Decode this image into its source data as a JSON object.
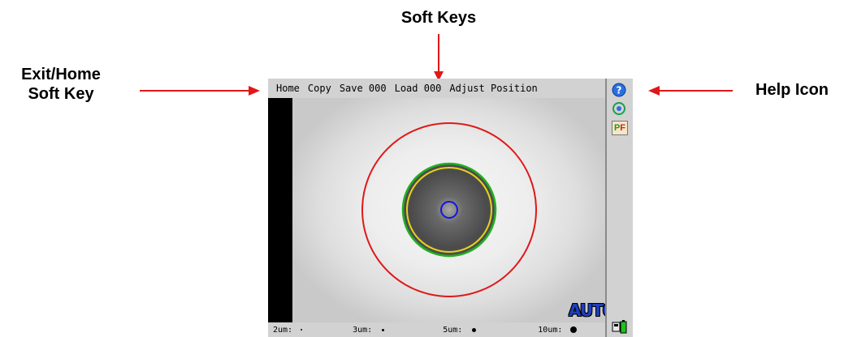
{
  "callouts": {
    "soft_keys": "Soft Keys",
    "exit_home_line1": "Exit/Home",
    "exit_home_line2": "Soft Key",
    "help_icon": "Help Icon"
  },
  "softkeys": {
    "home": "Home",
    "copy": "Copy",
    "save": "Save 000",
    "load": "Load 000",
    "adjust": "Adjust Position"
  },
  "mode_badge": "AUTO",
  "scale": [
    {
      "label": "2um:",
      "dot": "tiny"
    },
    {
      "label": "3um:",
      "dot": "small"
    },
    {
      "label": "5um:",
      "dot": "medium"
    },
    {
      "label": "10um:",
      "dot": "large"
    }
  ],
  "side_icons": {
    "help": "help-icon",
    "target": "target-icon",
    "pass_fail": "pass-fail-icon",
    "pf_letters": "PF",
    "battery": "battery-icon"
  },
  "colors": {
    "red_ring": "#e01818",
    "green_ring": "#22b022",
    "yellow_ring": "#e8d21a",
    "blue_ring": "#1414e0",
    "auto_badge": "#1f3fbf",
    "arrow": "#e01818"
  }
}
